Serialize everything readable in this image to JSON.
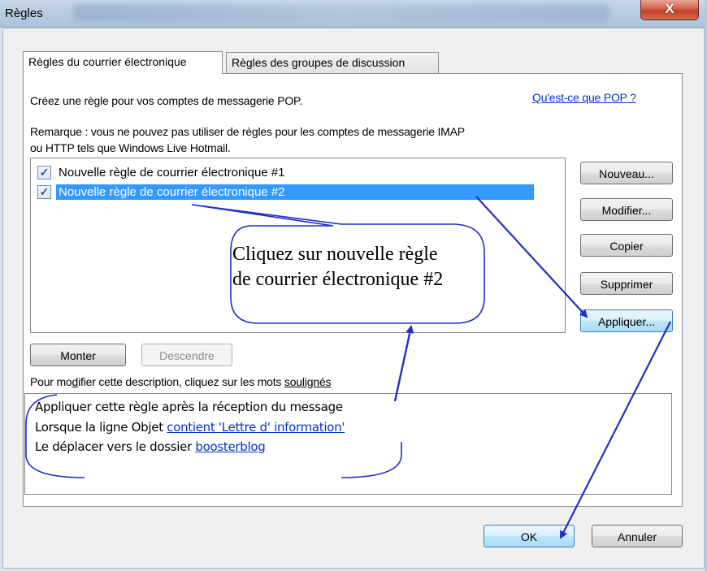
{
  "window": {
    "title": "Règles",
    "close_glyph": "X"
  },
  "tabs": [
    {
      "label": "Règles du courrier électronique",
      "active": true
    },
    {
      "label": "Règles des groupes de discussion",
      "active": false
    }
  ],
  "intro": {
    "text": "Créez une règle pour vos comptes de messagerie POP.",
    "pop_link": "Qu'est-ce que POP ?"
  },
  "remark": {
    "line1": "Remarque : vous ne pouvez pas utiliser de règles pour les comptes de messagerie IMAP",
    "line2": "ou HTTP tels que Windows Live Hotmail."
  },
  "rules": [
    {
      "label": "Nouvelle règle de courrier électronique #1",
      "checked": true,
      "selected": false
    },
    {
      "label": "Nouvelle règle de courrier électronique #2",
      "checked": true,
      "selected": true
    }
  ],
  "side_buttons": {
    "new": "Nouveau...",
    "modify": "Modifier...",
    "copy": "Copier",
    "delete": "Supprimer",
    "apply": "Appliquer..."
  },
  "move_buttons": {
    "up": "Monter",
    "down": "Descendre"
  },
  "description_hint": {
    "prefix": "Pour ",
    "word1": "mo",
    "word1_u": "d",
    "word1_rest": "ifier cette description, cliquez sur les mots ",
    "word2": "soulignés"
  },
  "description": {
    "line1": "Appliquer cette règle après la réception du message",
    "line2_prefix": "Lorsque la ligne Objet ",
    "line2_link": "contient 'Lettre d' information'",
    "line3_prefix": "Le déplacer vers le dossier ",
    "line3_link": "boosterblog"
  },
  "callout": {
    "line1": "Cliquez sur nouvelle règle",
    "line2": "de courrier électronique #2"
  },
  "footer_buttons": {
    "ok": "OK",
    "cancel": "Annuler"
  },
  "colors": {
    "selection": "#3399ff",
    "link": "#0033cc",
    "annotation": "#1e2fc8",
    "close": "#c94a33"
  },
  "icons": {
    "checkbox": "checkmark-icon",
    "close": "close-icon"
  }
}
